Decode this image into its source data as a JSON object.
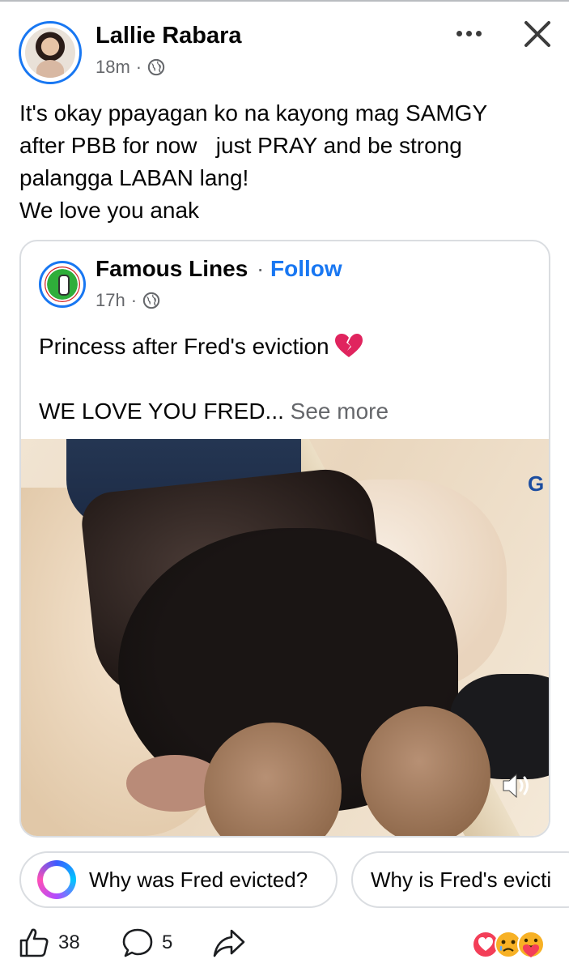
{
  "post": {
    "author": "Lallie Rabara",
    "time": "18m",
    "separator": "·",
    "text_lines": [
      "It's okay ppayagan ko na kayong mag SAMGY",
      "after PBB for now   just PRAY and be strong",
      "palangga LABAN lang!",
      "We love you anak"
    ]
  },
  "shared": {
    "page_name": "Famous Lines",
    "separator": "·",
    "follow_label": "Follow",
    "time": "17h",
    "line1": "Princess after Fred's eviction",
    "line2": "WE LOVE YOU FRED...",
    "see_more": "See more",
    "video_logo": "G"
  },
  "suggestions": [
    "Why was Fred evicted?",
    "Why is Fred's evicti"
  ],
  "actions": {
    "likes": "38",
    "comments": "5"
  },
  "colors": {
    "accent": "#1877f2",
    "muted": "#65676b",
    "border": "#dadde1"
  },
  "icons": [
    "globe-icon",
    "more-icon",
    "close-icon",
    "broken-heart-icon",
    "sound-icon",
    "meta-ai-icon",
    "like-icon",
    "comment-icon",
    "share-icon",
    "reaction-icons"
  ]
}
